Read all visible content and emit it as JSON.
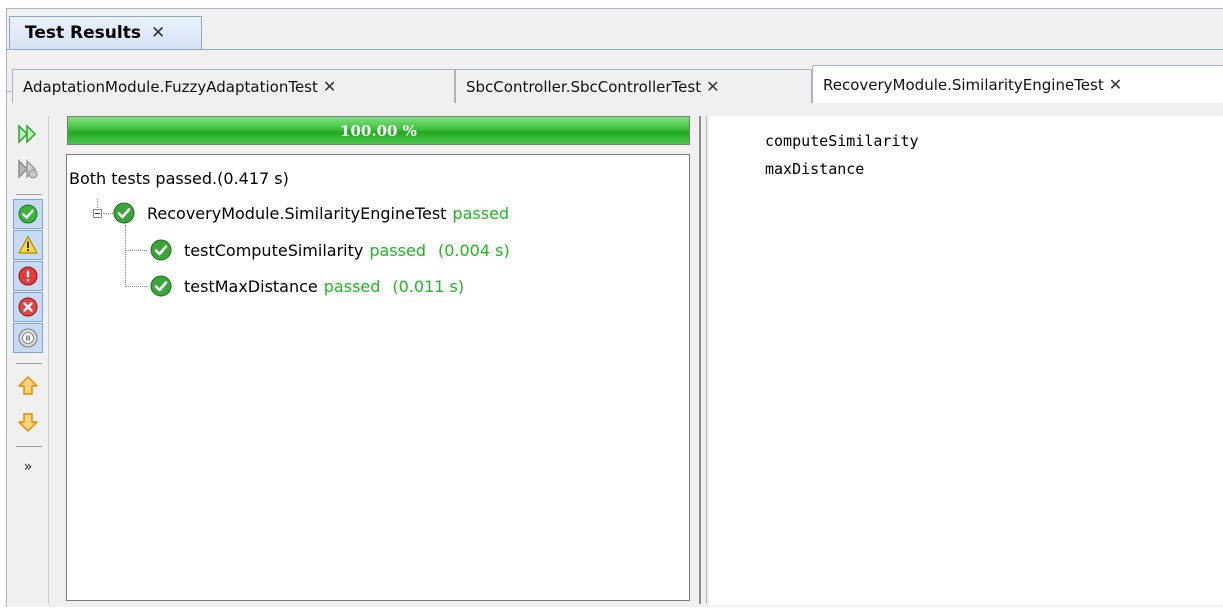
{
  "view_tab": {
    "label": "Test Results",
    "close": "✕"
  },
  "subtabs": [
    {
      "label": "AdaptationModule.FuzzyAdaptationTest",
      "close": "✕"
    },
    {
      "label": "SbcController.SbcControllerTest",
      "close": "✕"
    },
    {
      "label": "RecoveryModule.SimilarityEngineTest",
      "close": "✕"
    }
  ],
  "active_subtab_index": 2,
  "progress": {
    "value": 1.0,
    "label": "100.00 %"
  },
  "summary": "Both tests passed.(0.417 s)",
  "tree": {
    "root": {
      "name": "RecoveryModule.SimilarityEngineTest",
      "status": "passed"
    },
    "children": [
      {
        "name": "testComputeSimilarity",
        "status": "passed",
        "time": "(0.004 s)"
      },
      {
        "name": "testMaxDistance",
        "status": "passed",
        "time": "(0.011 s)"
      }
    ]
  },
  "toolbar": {
    "rerun_icon": "double-play-icon",
    "rerun_failed_icon": "rerun-failed-icon",
    "filters": [
      "passed-icon",
      "warning-icon",
      "error-icon",
      "failure-icon",
      "skipped-icon"
    ],
    "nav": [
      "previous-up-arrow-icon",
      "next-down-arrow-icon"
    ],
    "more": "»"
  },
  "output_lines": [
    "computeSimilarity",
    "maxDistance"
  ],
  "colors": {
    "pass_green": "#1fb81f",
    "selected_bg": "#c6dbf3",
    "tab_border": "#8ea6c7"
  }
}
